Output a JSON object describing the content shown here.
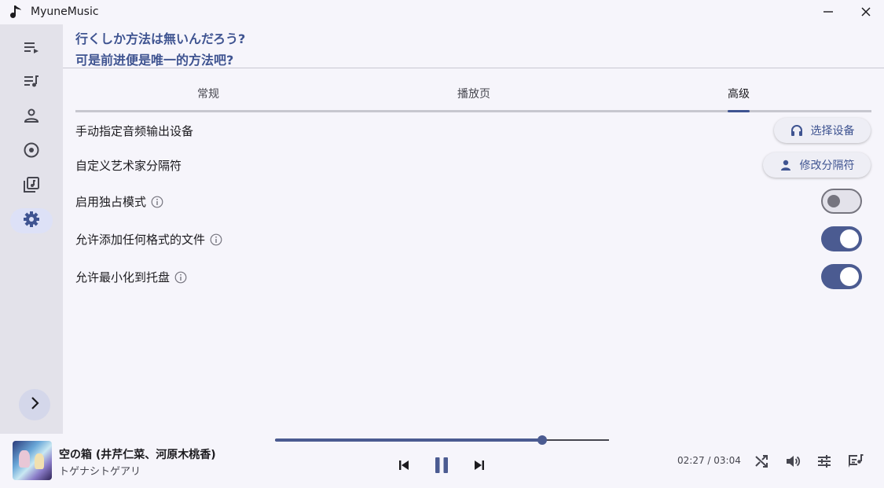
{
  "app": {
    "title": "MyuneMusic"
  },
  "window": {
    "minimize_icon": "minimize-icon",
    "close_icon": "close-icon"
  },
  "sidebar": {
    "items": [
      {
        "icon": "now-playing-list-icon",
        "active": false
      },
      {
        "icon": "playlist-icon",
        "active": false
      },
      {
        "icon": "artist-icon",
        "active": false
      },
      {
        "icon": "album-icon",
        "active": false
      },
      {
        "icon": "music-library-icon",
        "active": false
      },
      {
        "icon": "settings-icon",
        "active": true
      }
    ],
    "expand_icon": "chevron-right-icon"
  },
  "lyrics": {
    "line1": "行くしか方法は無いんだろう?",
    "line2": "可是前进便是唯一的方法吧?"
  },
  "tabs": [
    {
      "label": "常规"
    },
    {
      "label": "播放页"
    },
    {
      "label": "高级",
      "active": true
    }
  ],
  "settings": {
    "output_device": {
      "label": "手动指定音频输出设备",
      "button": "选择设备",
      "icon": "headphones-icon"
    },
    "artist_separator": {
      "label": "自定义艺术家分隔符",
      "button": "修改分隔符",
      "icon": "person-icon"
    },
    "exclusive_mode": {
      "label": "启用独占模式",
      "enabled": false
    },
    "any_format": {
      "label": "允许添加任何格式的文件",
      "enabled": true
    },
    "minimize_tray": {
      "label": "允许最小化到托盘",
      "enabled": true
    }
  },
  "player": {
    "title": "空の箱 (井芹仁菜、河原木桃香)",
    "artist": "トゲナシトゲアリ",
    "current_time": "02:27",
    "separator": " / ",
    "total_time": "03:04",
    "progress": 0.8,
    "accent": "#4b5b91"
  },
  "colors": {
    "accent": "#3f5491",
    "switch_on": "#4b5b91",
    "sidebar_bg": "#e3e2ea"
  }
}
